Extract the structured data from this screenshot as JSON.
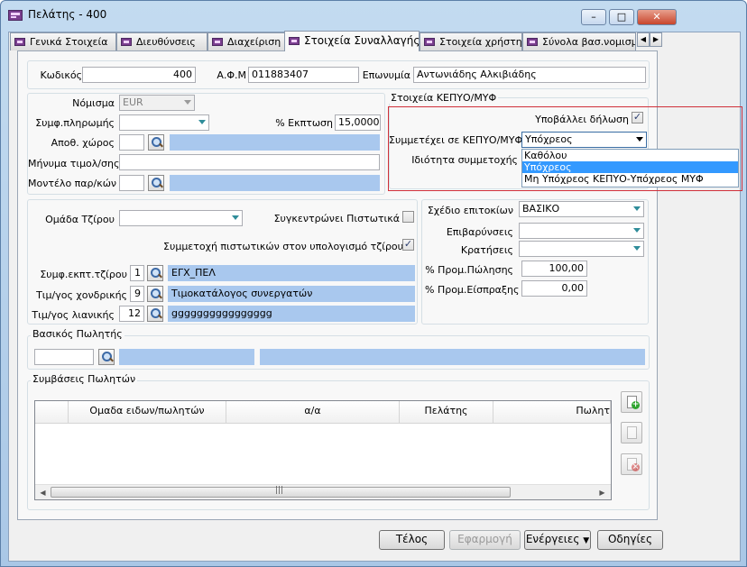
{
  "window": {
    "title": "Πελάτης - 400",
    "controls": {
      "minimize": "–",
      "maximize": "□",
      "close": "✕"
    }
  },
  "tabs": [
    {
      "label": "Γενικά Στοιχεία"
    },
    {
      "label": "Διευθύνσεις"
    },
    {
      "label": "Διαχείριση"
    },
    {
      "label": "Στοιχεία Συναλλαγής",
      "active": true
    },
    {
      "label": "Στοιχεία χρήστη"
    },
    {
      "label": "Σύνολα βασ.νομισμ"
    }
  ],
  "tab_scroll": {
    "left": "◀",
    "right": "▶"
  },
  "header": {
    "code_label": "Κωδικός",
    "code_value": "400",
    "afm_label": "Α.Φ.Μ",
    "afm_value": "011883407",
    "name_label": "Επωνυμία",
    "name_value": "Αντωνιάδης Αλκιβιάδης"
  },
  "left_top": {
    "currency_label": "Νόμισμα",
    "currency_value": "EUR",
    "payment_label": "Συμφ.πληρωμής",
    "payment_value": "",
    "discount_label": "% Εκπτωση",
    "discount_value": "15,0000",
    "warehouse_label": "Αποθ. χώρος",
    "warehouse_code": "",
    "warehouse_name": "",
    "message_label": "Μήνυμα τιμολ/σης",
    "message_value": "",
    "model_label": "Μοντέλο παρ/κών",
    "model_code": "",
    "model_name": ""
  },
  "kepyo": {
    "group_title": "Στοιχεία ΚΕΠΥΟ/ΜΥΦ",
    "submits_label": "Υποβάλλει δήλωση",
    "submits_checked": "✓",
    "participates_label": "Συμμετέχει σε ΚΕΠΥΟ/ΜΥΦ",
    "participates_value": "Υπόχρεος",
    "capacity_label": "Ιδιότητα συμμετοχής",
    "options": [
      "Καθόλου",
      "Υπόχρεος",
      "Μη Υπόχρεος ΚΕΠΥΟ-Υπόχρεος ΜΥΦ"
    ],
    "selected_option": "Υπόχρεος"
  },
  "credit": {
    "turnover_group_label": "Ομάδα Τζίρου",
    "turnover_group_value": "",
    "collects_credits_label": "Συγκεντρώνει Πιστωτικά",
    "collects_credits_checked": "",
    "credits_turnover_label": "Συμμετοχή πιστωτικών στον υπολογισμό τζίρου",
    "credits_turnover_checked": "✓",
    "turnover_discount_label": "Συμφ.εκπτ.τζίρου",
    "turnover_discount_code": "1",
    "turnover_discount_name": "ΕΓΧ_ΠΕΛ",
    "wholesale_label": "Τιμ/γος χονδρικής",
    "wholesale_code": "9",
    "wholesale_name": "Τιμοκατάλογος συνεργατών",
    "retail_label": "Τιμ/γος λιανικής",
    "retail_code": "12",
    "retail_name": "gggggggggggggggg"
  },
  "right_mid": {
    "interest_label": "Σχέδιο επιτοκίων",
    "interest_value": "ΒΑΣΙΚΟ",
    "charges_label": "Επιβαρύνσεις",
    "charges_value": "",
    "deductions_label": "Κρατήσεις",
    "deductions_value": "",
    "sales_comm_label": "% Προμ.Πώλησης",
    "sales_comm_value": "100,00",
    "collect_comm_label": "% Προμ.Είσπραξης",
    "collect_comm_value": "0,00"
  },
  "salesman": {
    "group_title": "Βασικός Πωλητής",
    "code": "",
    "name": "",
    "extra": ""
  },
  "contracts": {
    "group_title": "Συμβάσεις Πωλητών",
    "columns": [
      "",
      "Ομαδα ειδων/πωλητών",
      "α/α",
      "Πελάτης",
      "Πωλητ"
    ],
    "scroll_grip": "|||"
  },
  "buttons": {
    "ok": "Τέλος",
    "apply": "Εφαρμογή",
    "actions": "Ενέργειες",
    "actions_arrow": "▼",
    "help": "Οδηγίες"
  }
}
